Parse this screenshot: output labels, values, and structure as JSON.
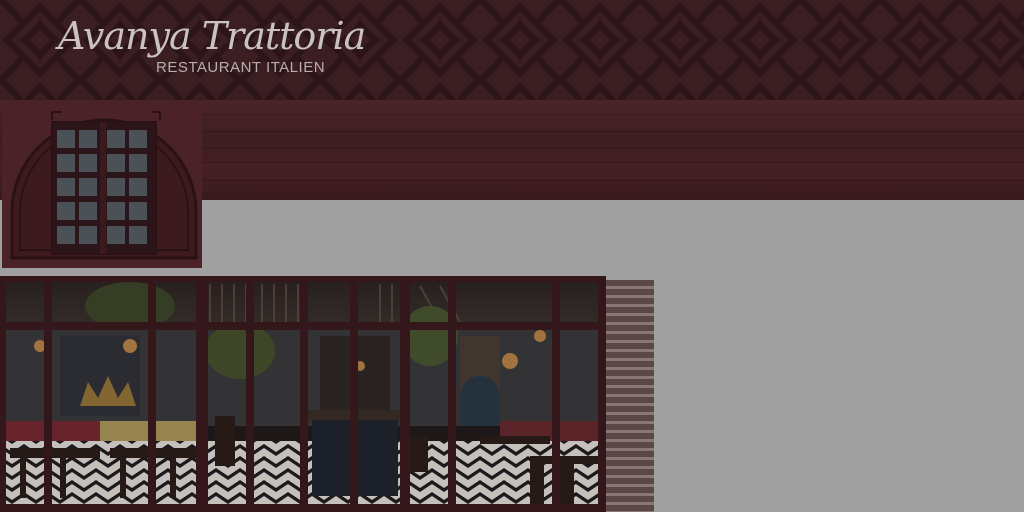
{
  "brand": {
    "name": "Avanya Trattoria",
    "subtitle": "RESTAURANT ITALIEN"
  },
  "icons": {
    "logo": "logo-script",
    "arch_window": "arched-window-icon"
  },
  "colors": {
    "header_bg": "#3a1e22",
    "wood": "#451f24",
    "frame": "#3b1a1f",
    "page_bg": "#a0a0a0"
  }
}
